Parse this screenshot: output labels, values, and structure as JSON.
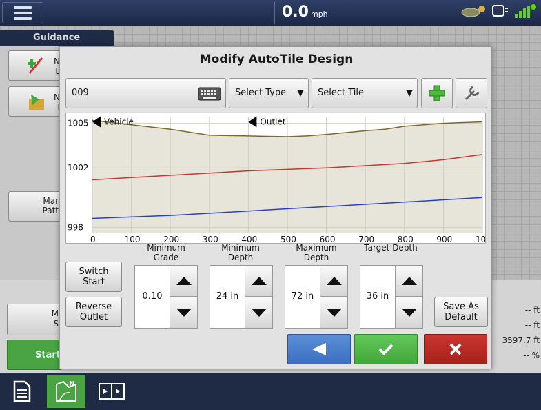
{
  "topbar": {
    "speed_value": "0.0",
    "speed_unit": "mph"
  },
  "guidance": {
    "tab_label": "Guidance"
  },
  "left_buttons": [
    {
      "label": "N\nL"
    },
    {
      "label": "N\nI"
    },
    {
      "label": "Mar\nPatt"
    }
  ],
  "bottom_left": {
    "m_button": "M\nS",
    "start_button": "Start"
  },
  "right_values": [
    "-- ft",
    "-- ft",
    "3597.7 ft",
    "-- %"
  ],
  "dialog": {
    "title": "Modify AutoTile Design",
    "design_name": "009",
    "type_select": "Select Type",
    "tile_select": "Select Tile",
    "switch_start": "Switch Start",
    "reverse_outlet": "Reverse Outlet",
    "save_default": "Save As Default",
    "min_grade_label": "Minimum Grade",
    "min_grade_value": "0.10",
    "min_depth_label": "Minimum Depth",
    "min_depth_value": "24 in",
    "max_depth_label": "Maximum Depth",
    "max_depth_value": "72 in",
    "target_depth_label": "Target Depth",
    "target_depth_value": "36 in"
  },
  "chart_data": {
    "type": "line",
    "x_ticks": [
      "0",
      "100",
      "200",
      "300",
      "400",
      "500",
      "600",
      "700",
      "800",
      "900",
      "10"
    ],
    "y_ticks": [
      "1005",
      "1002",
      "998"
    ],
    "xlim": [
      0,
      1000
    ],
    "ylim": [
      997.6,
      1005.4
    ],
    "markers": [
      {
        "label": "Vehicle",
        "x": 0
      },
      {
        "label": "Outlet",
        "x": 400
      }
    ],
    "series": [
      {
        "color": "#7a6a2a",
        "x": [
          0,
          100,
          200,
          250,
          300,
          400,
          500,
          550,
          600,
          700,
          750,
          800,
          850,
          900,
          950,
          1000
        ],
        "y": [
          1005.2,
          1004.9,
          1004.6,
          1004.4,
          1004.2,
          1004.15,
          1004.1,
          1004.15,
          1004.25,
          1004.5,
          1004.6,
          1004.8,
          1004.9,
          1005.0,
          1005.05,
          1005.1
        ]
      },
      {
        "color": "#c8372d",
        "x": [
          0,
          200,
          400,
          600,
          700,
          800,
          900,
          1000
        ],
        "y": [
          1001.2,
          1001.5,
          1001.8,
          1002.0,
          1002.15,
          1002.3,
          1002.55,
          1002.9
        ]
      },
      {
        "color": "#2a3fc7",
        "x": [
          0,
          200,
          400,
          600,
          800,
          1000
        ],
        "y": [
          998.6,
          998.8,
          999.1,
          999.4,
          999.7,
          1000.0
        ]
      }
    ],
    "fill_color": "#e7e4da"
  }
}
